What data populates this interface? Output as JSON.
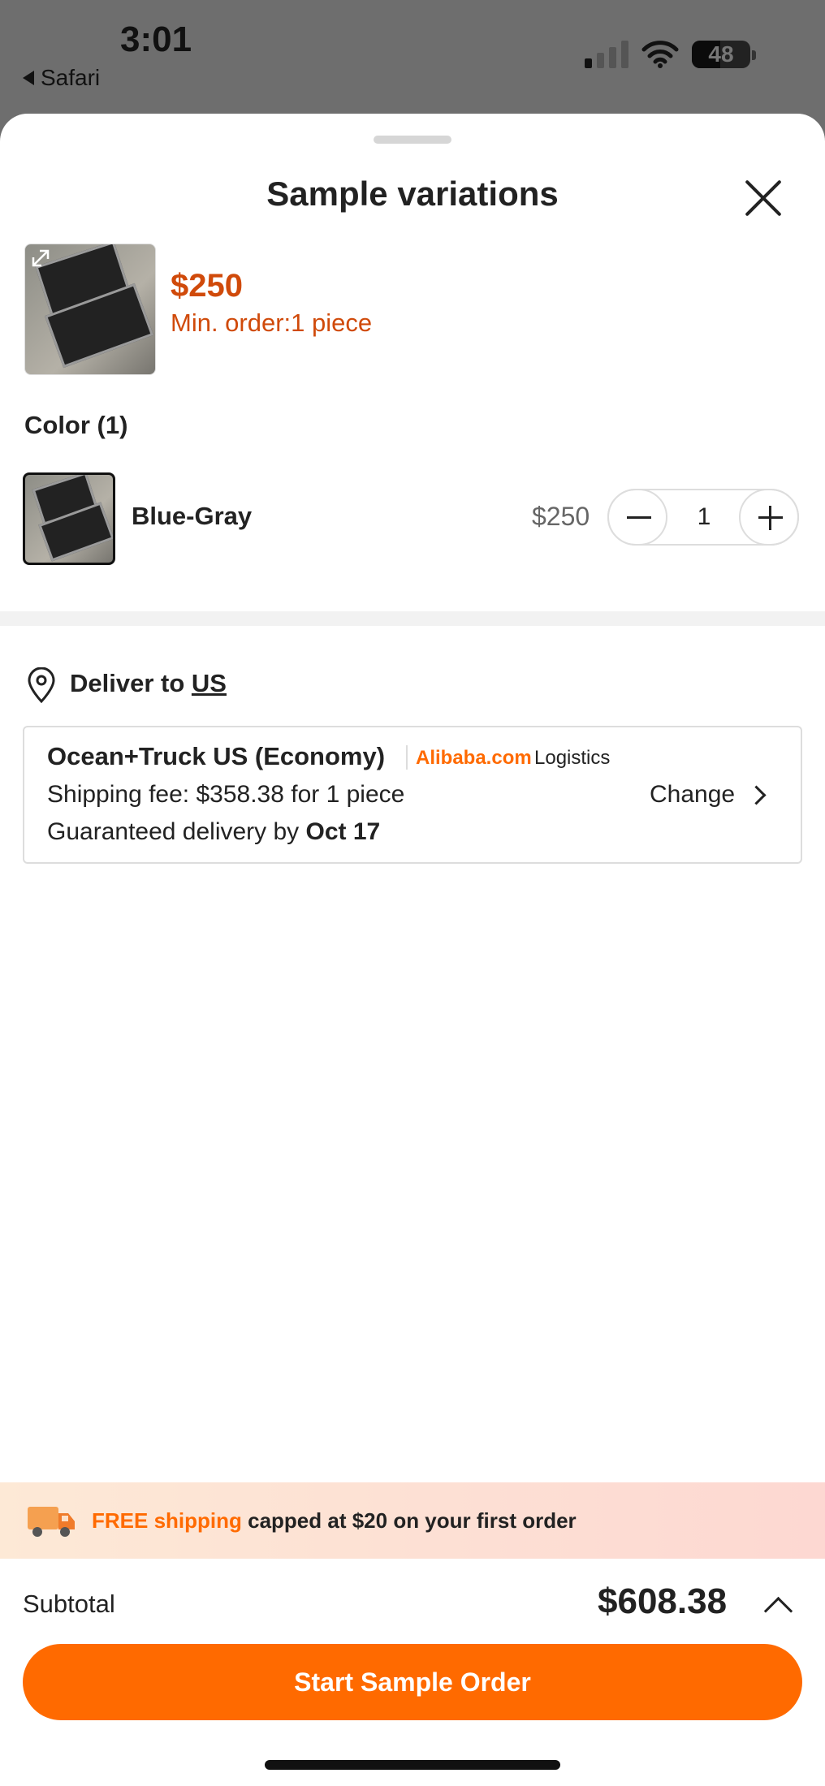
{
  "status_bar": {
    "time": "3:01",
    "back_app": "Safari",
    "battery_level": "48",
    "battery_fraction": 0.48
  },
  "sheet": {
    "title": "Sample variations",
    "close_icon": "close-icon"
  },
  "product": {
    "price": "$250",
    "min_order": "Min. order:1 piece",
    "expand_icon": "expand-icon"
  },
  "color_section": {
    "heading": "Color (1)",
    "variants": [
      {
        "name": "Blue-Gray",
        "price": "$250",
        "quantity": "1"
      }
    ]
  },
  "delivery": {
    "label": "Deliver to",
    "country": "US",
    "method": "Ocean+Truck US (Economy)",
    "brand": "Alibaba.com",
    "brand_suffix": "Logistics",
    "fee": "Shipping fee: $358.38 for 1 piece",
    "guarantee_prefix": "Guaranteed delivery by",
    "guarantee_date": "Oct 17",
    "change_label": "Change"
  },
  "promo": {
    "highlight": "FREE shipping",
    "text": "capped at $20 on your first order"
  },
  "footer": {
    "subtotal_label": "Subtotal",
    "subtotal_value": "$608.38",
    "cta_label": "Start Sample Order"
  },
  "colors": {
    "accent": "#ff6a00",
    "price": "#d04a0a",
    "text": "#222222"
  }
}
